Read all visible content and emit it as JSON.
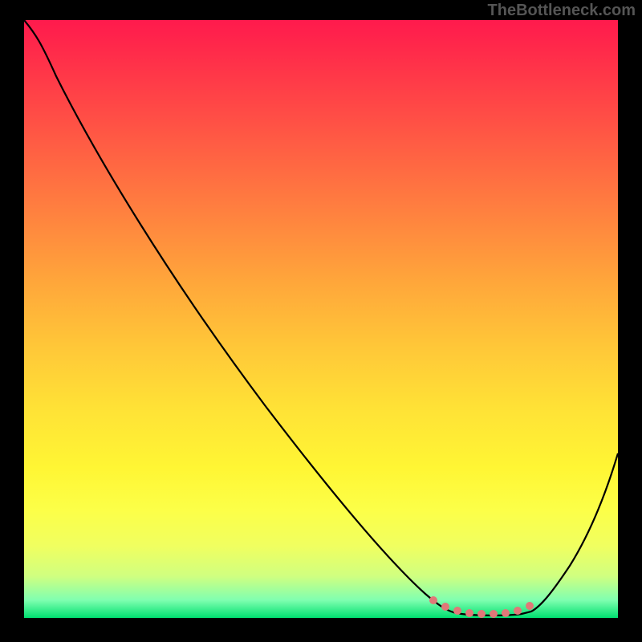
{
  "watermark": "TheBottleneck.com",
  "chart_data": {
    "type": "line",
    "title": "",
    "xlabel": "",
    "ylabel": "",
    "xlim": [
      0,
      100
    ],
    "ylim": [
      0,
      100
    ],
    "series": [
      {
        "name": "bottleneck-curve",
        "x": [
          0,
          3,
          10,
          20,
          30,
          40,
          50,
          60,
          66,
          70,
          72,
          76,
          80,
          84,
          86,
          90,
          95,
          100
        ],
        "y": [
          100,
          98,
          90,
          78,
          65,
          52,
          40,
          27,
          18,
          10,
          5,
          1,
          0,
          0,
          1,
          8,
          18,
          30
        ]
      }
    ],
    "markers": {
      "name": "bottom-markers",
      "x": [
        70,
        72,
        74,
        76,
        78,
        80,
        82,
        84,
        86
      ],
      "y": [
        2.5,
        1.5,
        1,
        0.8,
        0.6,
        0.6,
        0.8,
        1.2,
        2
      ],
      "color": "#e07878"
    },
    "gradient_stops": [
      {
        "pos": 0,
        "color": "#ff1a4d"
      },
      {
        "pos": 50,
        "color": "#ffc040"
      },
      {
        "pos": 85,
        "color": "#f8ff50"
      },
      {
        "pos": 100,
        "color": "#00e070"
      }
    ]
  }
}
